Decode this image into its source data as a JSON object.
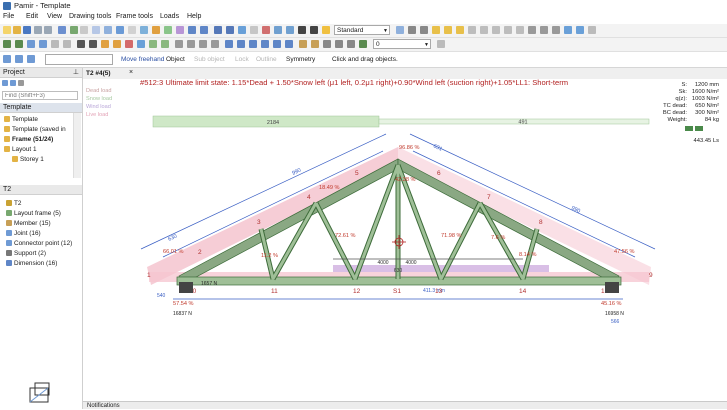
{
  "app": {
    "title": "Pamir - Template"
  },
  "menu": [
    "File",
    "Edit",
    "View",
    "Drawing tools",
    "Frame tools",
    "Loads",
    "Help"
  ],
  "toolbar": {
    "style_combo": "Standard",
    "layer_combo": "0",
    "mode": "Move freehand",
    "options": [
      "Object",
      "Sub object",
      "Lock",
      "Outline",
      "Symmetry"
    ],
    "hint": "Click and drag objects."
  },
  "project_panel": {
    "title": "Project",
    "search_placeholder": "Find (Shift+F3)",
    "section": "Template",
    "items": [
      {
        "label": "Template"
      },
      {
        "label": "Template (saved in"
      },
      {
        "label": "Frame (51/24)"
      },
      {
        "label": "Layout 1"
      },
      {
        "label": "Storey 1"
      }
    ]
  },
  "object_panel": {
    "title": "T2",
    "items": [
      {
        "label": "T2"
      },
      {
        "label": "Layout frame (5)"
      },
      {
        "label": "Member (15)"
      },
      {
        "label": "Joint (16)"
      },
      {
        "label": "Connector point (12)"
      },
      {
        "label": "Support (2)"
      },
      {
        "label": "Dimension (16)"
      }
    ]
  },
  "drawing": {
    "tab": "T2 #4(5)",
    "load_case": "#512:3 Ultimate limit state: 1.15*Dead + 1.50*Snow left (μ1 left, 0.2μ1 right)+0.90*Wind left (suction right)+1.05*LL1: Short-term",
    "legend": [
      "Dead load",
      "Snow load",
      "Wind load",
      "Live load"
    ],
    "info": [
      {
        "k": "S:",
        "v": "1200 mm"
      },
      {
        "k": "Sk:",
        "v": "1600 N/m²"
      },
      {
        "k": "q(z):",
        "v": "1003 N/m²"
      },
      {
        "k": "TC dead:",
        "v": "650 N/m²"
      },
      {
        "k": "BC dead:",
        "v": "300 N/m²"
      },
      {
        "k": "Weight:",
        "v": "84 kg"
      },
      {
        "k": "",
        "v": "443.45 Ls"
      }
    ],
    "load_labels": {
      "snow_a": "2184",
      "snow_b": "491"
    },
    "utilization": [
      "96.86 %",
      "42.38 %",
      "18.49 %",
      "72.61 %",
      "71.98 %",
      "7.6 %",
      "66.01 %",
      "11.2 %",
      "8.14 %",
      "47.56 %",
      "57.54 %",
      "45.16 %"
    ],
    "joint_numbers": [
      "1",
      "2",
      "3",
      "4",
      "5",
      "6",
      "7",
      "8",
      "9",
      "10",
      "11",
      "12",
      "S1",
      "13",
      "14",
      "15"
    ],
    "dims": {
      "top_left": "990",
      "top_right": "990",
      "seg_left": "630",
      "seg_right": "631",
      "bot_left": "4000",
      "bot_right": "4000",
      "bot_mid": "630",
      "overall": "411.3 mm"
    },
    "reactions": {
      "left": "1657 N",
      "left_b": "16837 N",
      "right": "16958 N",
      "left_small": "540",
      "right_small": "566"
    }
  },
  "notifications": {
    "title": "Notifications"
  },
  "colors": {
    "member": "#8aa883",
    "member_dark": "#3d6b3a",
    "load_pink": "#f2a7b8",
    "load_green": "#c8e4c0",
    "load_purple": "#d7b6e3",
    "dim_blue": "#3a5fc4",
    "util_red": "#c0392b"
  }
}
